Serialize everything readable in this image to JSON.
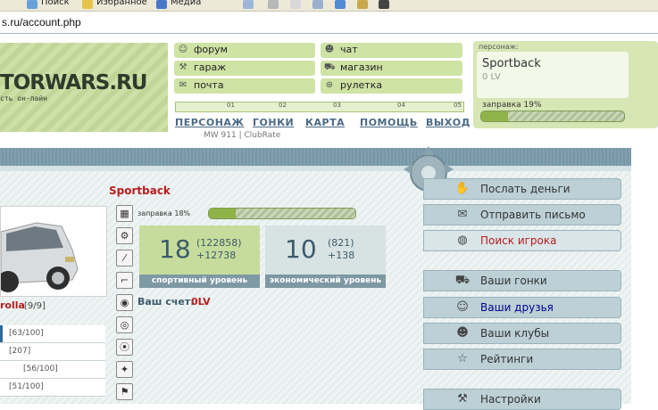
{
  "browser": {
    "toolbar": [
      "Поиск",
      "Избранное",
      "Медиа"
    ],
    "address": "s.ru/account.php"
  },
  "header": {
    "logo_text": "TORWARS.RU",
    "logo_subtext": "сть он-лайн",
    "menu": [
      {
        "label": "форум",
        "icon": "forum-icon"
      },
      {
        "label": "чат",
        "icon": "chat-icon"
      },
      {
        "label": "гараж",
        "icon": "garage-icon"
      },
      {
        "label": "магазин",
        "icon": "shop-icon"
      },
      {
        "label": "почта",
        "icon": "mail-icon"
      },
      {
        "label": "рулетка",
        "icon": "roulette-icon"
      }
    ],
    "ruler_numbers": [
      "01",
      "02",
      "03",
      "04",
      "05"
    ],
    "nav": [
      "ПЕРСОНАЖ",
      "ГОНКИ",
      "КАРТА",
      "ПОМОЩЬ",
      "ВЫХОД"
    ],
    "car_model": "MW 911 | ClubRate"
  },
  "character": {
    "label": "персонаж:",
    "name": "Sportback",
    "level": "0 LV",
    "fuel_label": "заправка 19%",
    "fuel_percent": 19
  },
  "profile": {
    "name": "Sportback",
    "fuel_label": "заправка 18%",
    "fuel_percent": 18,
    "car_name": "rolla",
    "car_condition": "[9/9]",
    "stats": [
      "[63/100]",
      "[207]",
      "[56/100]",
      "[51/100]"
    ],
    "sport": {
      "level": "18",
      "detail_1": "(122858)",
      "detail_2": "+12738",
      "caption": "спортивный уровень"
    },
    "economy": {
      "level": "10",
      "detail_1": "(821)",
      "detail_2": "+138",
      "caption": "экономический уровень"
    },
    "account_label": "Ваш счет:",
    "account_value": "0LV"
  },
  "right_menu": [
    {
      "label": "Послать деньги",
      "icon": "money-icon"
    },
    {
      "label": "Отправить письмо",
      "icon": "letter-icon"
    },
    {
      "label": "Поиск игрока",
      "icon": "search-player-icon"
    },
    {
      "label": "Ваши гонки",
      "icon": "race-car-icon"
    },
    {
      "label": "Ваши друзья",
      "icon": "friends-icon"
    },
    {
      "label": "Ваши клубы",
      "icon": "clubs-icon"
    },
    {
      "label": "Рейтинги",
      "icon": "star-icon"
    },
    {
      "label": "Настройки",
      "icon": "tools-icon"
    }
  ],
  "colors": {
    "accent_green": "#cfe3a4",
    "accent_red": "#b81d1d",
    "accent_blue": "#00008b",
    "band": "#7797a6"
  }
}
